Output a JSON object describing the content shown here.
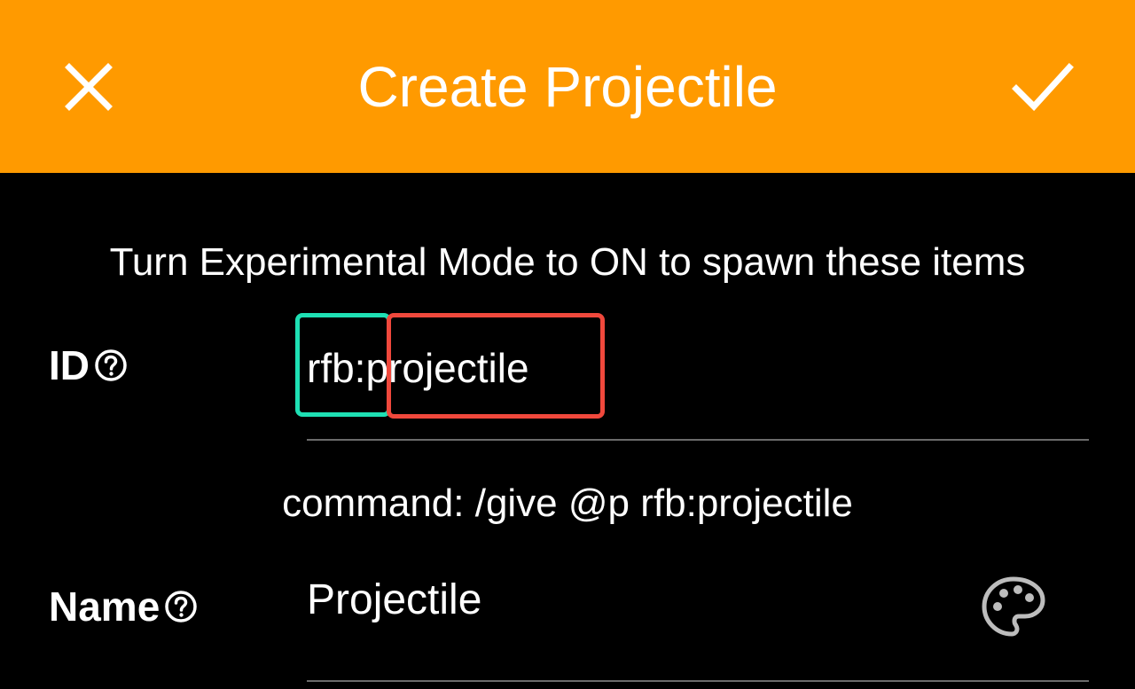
{
  "appbar": {
    "title": "Create Projectile",
    "background": "#ff9a00",
    "close_icon": "close-icon",
    "confirm_icon": "check-icon"
  },
  "notice": "Turn Experimental Mode to ON to spawn these items",
  "id_field": {
    "label": "ID",
    "help_icon": "help-circle-icon",
    "prefix": "rfb:",
    "value": "projectile",
    "prefix_highlight_color": "#1ee0b4",
    "value_highlight_color": "#f0483c"
  },
  "command": "command: /give @p rfb:projectile",
  "name_field": {
    "label": "Name",
    "help_icon": "help-circle-icon",
    "value": "Projectile",
    "color_icon": "palette-icon"
  }
}
